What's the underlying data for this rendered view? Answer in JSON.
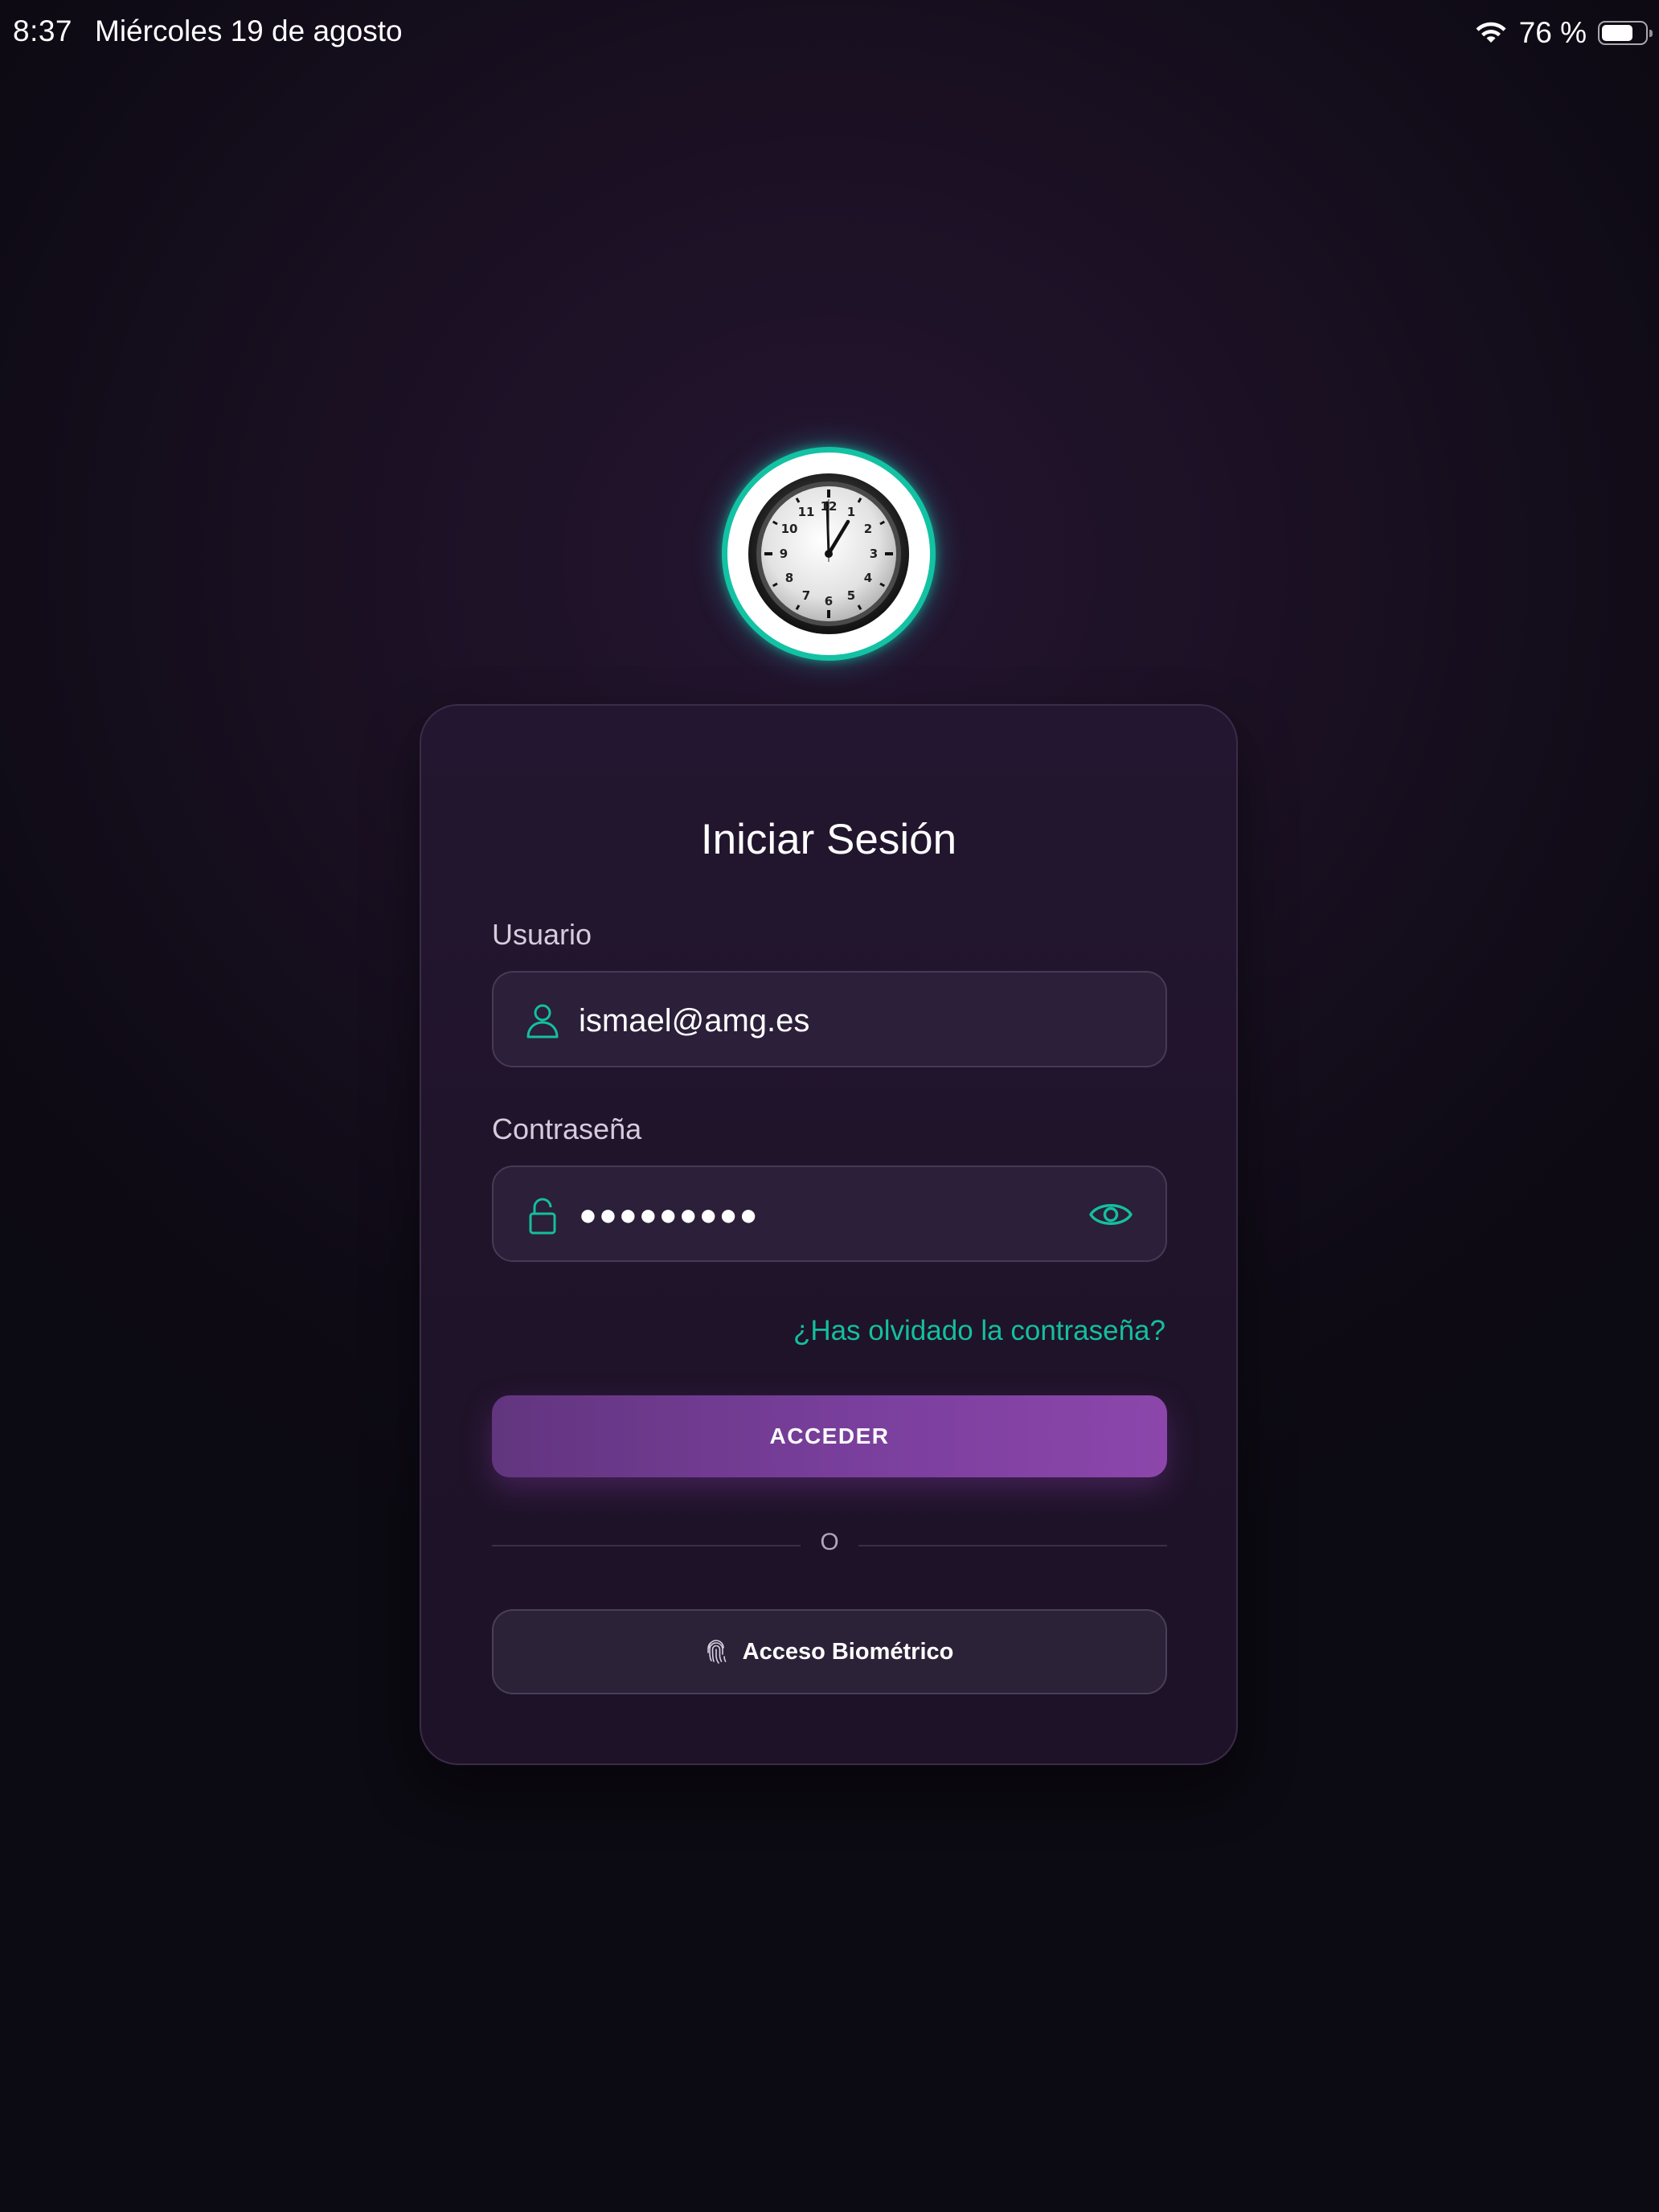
{
  "status_bar": {
    "time": "8:37",
    "date": "Miércoles 19 de agosto",
    "battery_percent": "76 %",
    "battery_level": 0.76,
    "icons": [
      "wifi-icon",
      "battery-icon"
    ]
  },
  "logo": {
    "icon": "clock-icon",
    "accent_color": "#13c2a3"
  },
  "login": {
    "title": "Iniciar Sesión",
    "username": {
      "label": "Usuario",
      "value": "ismael@amg.es",
      "icon": "user-icon"
    },
    "password": {
      "label": "Contraseña",
      "value": "●●●●●●●●●",
      "icon": "lock-icon",
      "toggle_icon": "eye-icon"
    },
    "forgot_link": "¿Has olvidado la contraseña?",
    "submit_label": "ACCEDER",
    "divider_text": "O",
    "biometric_label": "Acceso Biométrico",
    "biometric_icon": "fingerprint-icon"
  },
  "colors": {
    "accent": "#14bf9f",
    "primary_button_start": "#62357f",
    "primary_button_end": "#8c46ab",
    "background": "#120c1a",
    "card": "#211430"
  }
}
